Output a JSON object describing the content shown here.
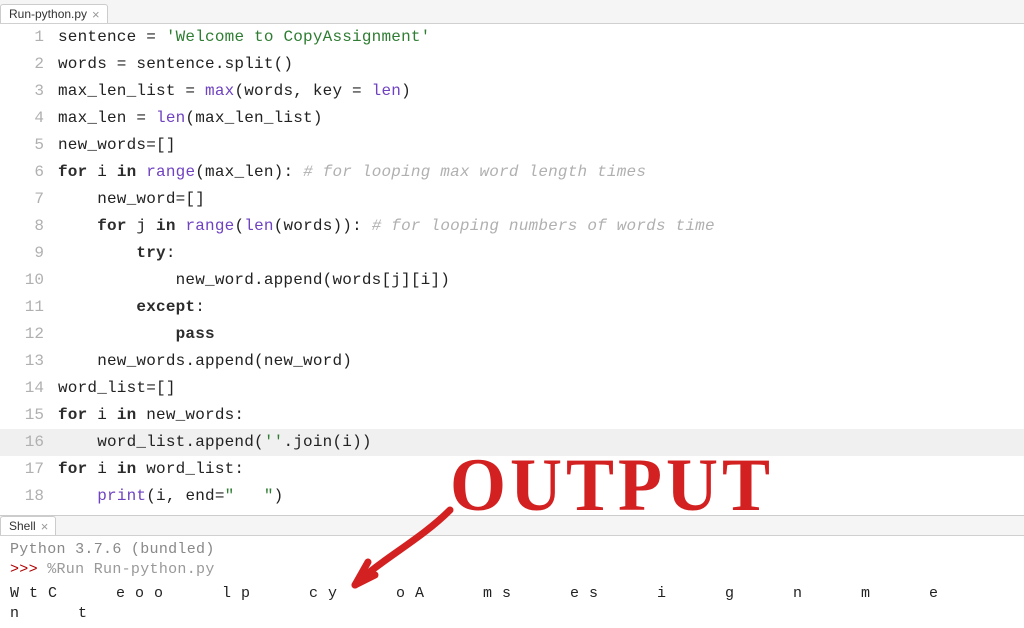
{
  "editor_tab": {
    "label": "Run-python.py"
  },
  "shell_tab": {
    "label": "Shell"
  },
  "gutter_lines": [
    "1",
    "2",
    "3",
    "4",
    "5",
    "6",
    "7",
    "8",
    "9",
    "10",
    "11",
    "12",
    "13",
    "14",
    "15",
    "16",
    "17",
    "18"
  ],
  "code": {
    "l1_var": "sentence = ",
    "l1_str": "'Welcome to CopyAssignment'",
    "l2": "words = sentence.split()",
    "l3_a": "max_len_list = ",
    "l3_b": "max",
    "l3_c": "(words, key = ",
    "l3_d": "len",
    "l3_e": ")",
    "l4_a": "max_len = ",
    "l4_b": "len",
    "l4_c": "(max_len_list)",
    "l5": "new_words=[]",
    "l6_a": "for",
    "l6_b": " i ",
    "l6_c": "in",
    "l6_d": " ",
    "l6_e": "range",
    "l6_f": "(max_len): ",
    "l6_g": "# for looping max word length times",
    "l7": "    new_word=[]",
    "l8_a": "    ",
    "l8_b": "for",
    "l8_c": " j ",
    "l8_d": "in",
    "l8_e": " ",
    "l8_f": "range",
    "l8_g": "(",
    "l8_h": "len",
    "l8_i": "(words)): ",
    "l8_j": "# for looping numbers of words time",
    "l9_a": "        ",
    "l9_b": "try",
    "l9_c": ":",
    "l10": "            new_word.append(words[j][i])",
    "l11_a": "        ",
    "l11_b": "except",
    "l11_c": ":",
    "l12_a": "            ",
    "l12_b": "pass",
    "l13": "    new_words.append(new_word)",
    "l14": "word_list=[]",
    "l15_a": "for",
    "l15_b": " i ",
    "l15_c": "in",
    "l15_d": " new_words:",
    "l16_a": "    word_list.append(",
    "l16_b": "''",
    "l16_c": ".join(i))",
    "l17_a": "for",
    "l17_b": " i ",
    "l17_c": "in",
    "l17_d": " word_list:",
    "l18_a": "    ",
    "l18_b": "print",
    "l18_c": "(i, end=",
    "l18_d": "\"   \"",
    "l18_e": ")"
  },
  "shell": {
    "version": "Python 3.7.6 (bundled)",
    "prompt": ">>>",
    "command": " %Run Run-python.py",
    "output": "WtC eoo lp cy oA ms es i g n m e n t"
  },
  "annotation": "OUTPUT"
}
